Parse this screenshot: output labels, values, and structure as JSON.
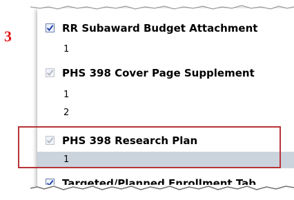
{
  "step": {
    "number": "3"
  },
  "forms": [
    {
      "title": "RR Subaward Budget Attachment",
      "checked": true,
      "enabled": true,
      "attachments": [
        "1"
      ]
    },
    {
      "title": "PHS 398 Cover Page Supplement",
      "checked": true,
      "enabled": false,
      "attachments": [
        "1",
        "2"
      ]
    },
    {
      "title": "PHS 398 Research Plan",
      "checked": true,
      "enabled": false,
      "attachments": [
        "1"
      ]
    },
    {
      "title": "Targeted/Planned Enrollment Tab",
      "checked": true,
      "enabled": true,
      "attachments": []
    }
  ],
  "colors": {
    "step_number": "#e01a1a",
    "highlight_border": "#b83237",
    "selected_row": "#cbd3dd",
    "check_enabled": "#1f3fa6",
    "check_disabled": "#b8b8b8"
  },
  "icons": {
    "checkbox": "checkmark-icon"
  }
}
